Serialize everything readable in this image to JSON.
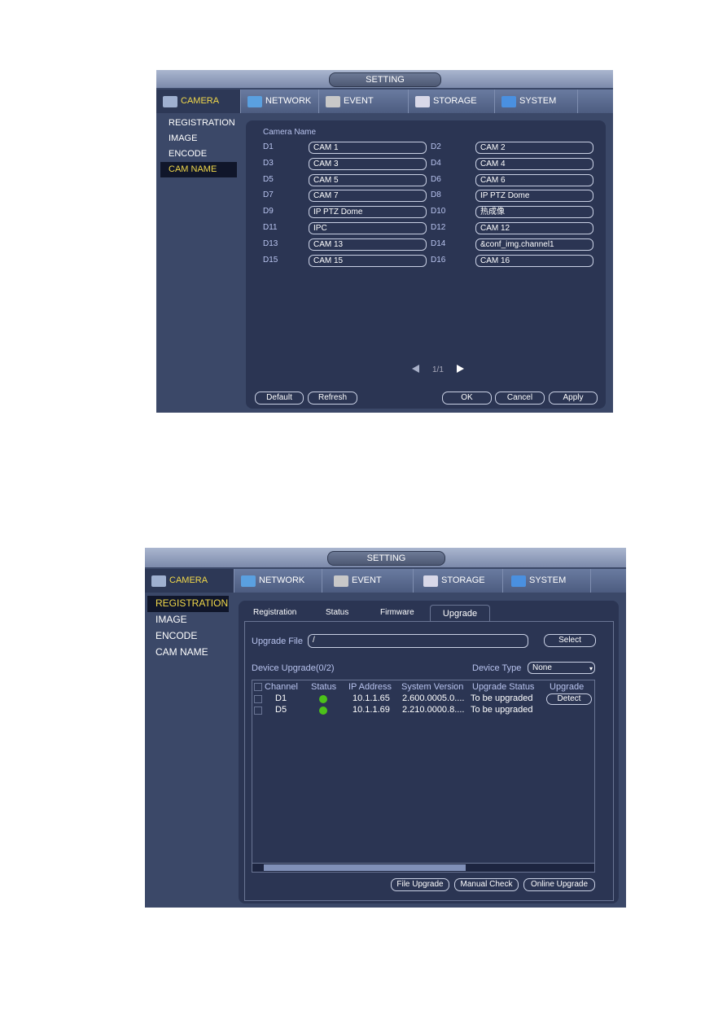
{
  "colors": {
    "accent": "#f2d94a",
    "panel": "#2b3553",
    "status_online": "#4cc21a"
  },
  "main_tabs": [
    {
      "label": "CAMERA",
      "icon": "camera-icon"
    },
    {
      "label": "NETWORK",
      "icon": "network-icon"
    },
    {
      "label": "EVENT",
      "icon": "event-icon"
    },
    {
      "label": "STORAGE",
      "icon": "storage-icon"
    },
    {
      "label": "SYSTEM",
      "icon": "system-icon"
    }
  ],
  "window_title": "SETTING",
  "sidebar": [
    "REGISTRATION",
    "IMAGE",
    "ENCODE",
    "CAM NAME"
  ],
  "screen1": {
    "section_title": "Camera Name",
    "selected_sidebar": "CAM NAME",
    "cameras": [
      {
        "ch": "D1",
        "name": "CAM 1"
      },
      {
        "ch": "D2",
        "name": "CAM 2"
      },
      {
        "ch": "D3",
        "name": "CAM 3"
      },
      {
        "ch": "D4",
        "name": "CAM 4"
      },
      {
        "ch": "D5",
        "name": "CAM 5"
      },
      {
        "ch": "D6",
        "name": "CAM 6"
      },
      {
        "ch": "D7",
        "name": "CAM 7"
      },
      {
        "ch": "D8",
        "name": "IP PTZ Dome"
      },
      {
        "ch": "D9",
        "name": "IP PTZ Dome"
      },
      {
        "ch": "D10",
        "name": "热成像"
      },
      {
        "ch": "D11",
        "name": "IPC"
      },
      {
        "ch": "D12",
        "name": "CAM 12"
      },
      {
        "ch": "D13",
        "name": "CAM 13"
      },
      {
        "ch": "D14",
        "name": "&conf_img.channel1"
      },
      {
        "ch": "D15",
        "name": "CAM 15"
      },
      {
        "ch": "D16",
        "name": "CAM 16"
      }
    ],
    "pager": "1/1",
    "buttons": {
      "default": "Default",
      "refresh": "Refresh",
      "ok": "OK",
      "cancel": "Cancel",
      "apply": "Apply"
    }
  },
  "screen2": {
    "selected_sidebar": "REGISTRATION",
    "sub_tabs": [
      "Registration",
      "Status",
      "Firmware",
      "Upgrade"
    ],
    "active_sub_tab": "Upgrade",
    "upgrade_file_label": "Upgrade File",
    "upgrade_file_value": "/",
    "select_button": "Select",
    "device_upgrade_label": "Device Upgrade(0/2)",
    "device_type_label": "Device Type",
    "device_type_value": "None",
    "columns": [
      "Channel",
      "Status",
      "IP Address",
      "System Version",
      "Upgrade Status",
      "Upgrade"
    ],
    "rows": [
      {
        "channel": "D1",
        "status": "online",
        "ip": "10.1.1.65",
        "version": "2.600.0005.0....",
        "upgrade_status": "To be upgraded",
        "action": "Detect"
      },
      {
        "channel": "D5",
        "status": "online",
        "ip": "10.1.1.69",
        "version": "2.210.0000.8....",
        "upgrade_status": "To be upgraded",
        "action": ""
      }
    ],
    "buttons": {
      "file_upgrade": "File Upgrade",
      "manual_check": "Manual Check",
      "online_upgrade": "Online Upgrade"
    }
  }
}
